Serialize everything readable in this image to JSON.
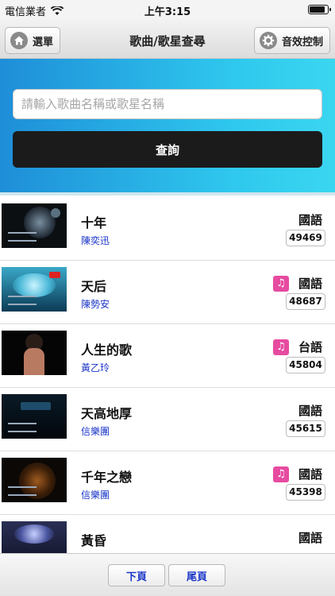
{
  "status_bar": {
    "carrier": "電信業者",
    "time": "上午3:15"
  },
  "nav": {
    "menu_label": "選單",
    "title": "歌曲/歌星查尋",
    "effects_label": "音效控制"
  },
  "search": {
    "placeholder": "請輸入歌曲名稱或歌星名稱",
    "button_label": "查詢"
  },
  "songs": [
    {
      "title": "十年",
      "artist": "陳奕迅",
      "language": "國語",
      "number": "49469",
      "has_music_icon": false
    },
    {
      "title": "天后",
      "artist": "陳勢安",
      "language": "國語",
      "number": "48687",
      "has_music_icon": true
    },
    {
      "title": "人生的歌",
      "artist": "黃乙玲",
      "language": "台語",
      "number": "45804",
      "has_music_icon": true
    },
    {
      "title": "天高地厚",
      "artist": "信樂團",
      "language": "國語",
      "number": "45615",
      "has_music_icon": false
    },
    {
      "title": "千年之戀",
      "artist": "信樂團",
      "language": "國語",
      "number": "45398",
      "has_music_icon": true
    },
    {
      "title": "黃昏",
      "artist": "",
      "language": "國語",
      "number": "",
      "has_music_icon": false
    }
  ],
  "pagination": {
    "next_label": "下頁",
    "last_label": "尾頁"
  },
  "colors": {
    "search_gradient_start": "#1e8ed8",
    "search_gradient_end": "#3ad6f0",
    "artist_link": "#1a35c8",
    "music_badge": "#e64ba0"
  },
  "icons": {
    "menu": "home-icon",
    "effects": "gear-icon",
    "music": "music-note-icon"
  }
}
